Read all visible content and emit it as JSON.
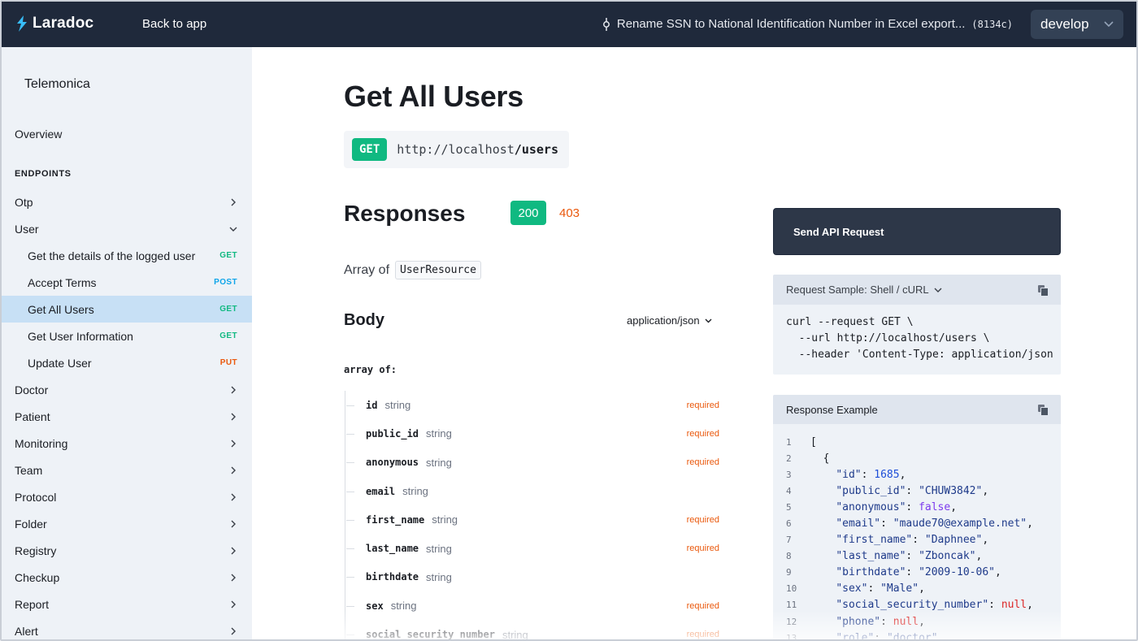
{
  "topbar": {
    "brand": "Laradoc",
    "back_link": "Back to app",
    "commit_message": "Rename SSN to National Identification Number in Excel export...",
    "commit_hash": "(8134c)",
    "branch": "develop"
  },
  "sidebar": {
    "project": "Telemonica",
    "overview": "Overview",
    "section": "ENDPOINTS",
    "items": [
      {
        "label": "Otp",
        "type": "group",
        "expanded": false
      },
      {
        "label": "User",
        "type": "group",
        "expanded": true
      },
      {
        "label": "Get the details of the logged user",
        "type": "endpoint",
        "method": "GET"
      },
      {
        "label": "Accept Terms",
        "type": "endpoint",
        "method": "POST"
      },
      {
        "label": "Get All Users",
        "type": "endpoint",
        "method": "GET",
        "active": true
      },
      {
        "label": "Get User Information",
        "type": "endpoint",
        "method": "GET"
      },
      {
        "label": "Update User",
        "type": "endpoint",
        "method": "PUT"
      },
      {
        "label": "Doctor",
        "type": "group",
        "expanded": false
      },
      {
        "label": "Patient",
        "type": "group",
        "expanded": false
      },
      {
        "label": "Monitoring",
        "type": "group",
        "expanded": false
      },
      {
        "label": "Team",
        "type": "group",
        "expanded": false
      },
      {
        "label": "Protocol",
        "type": "group",
        "expanded": false
      },
      {
        "label": "Folder",
        "type": "group",
        "expanded": false
      },
      {
        "label": "Registry",
        "type": "group",
        "expanded": false
      },
      {
        "label": "Checkup",
        "type": "group",
        "expanded": false
      },
      {
        "label": "Report",
        "type": "group",
        "expanded": false
      },
      {
        "label": "Alert",
        "type": "group",
        "expanded": false
      }
    ]
  },
  "main": {
    "title": "Get All Users",
    "method": "GET",
    "url_base": "http://localhost",
    "url_path": "/users",
    "responses_title": "Responses",
    "status_codes": [
      "200",
      "403"
    ],
    "array_of_label": "Array of",
    "resource_name": "UserResource",
    "body_title": "Body",
    "content_type": "application/json",
    "array_label": "array of:",
    "fields": [
      {
        "name": "id",
        "type": "string",
        "required": "required"
      },
      {
        "name": "public_id",
        "type": "string",
        "required": "required"
      },
      {
        "name": "anonymous",
        "type": "string",
        "required": "required"
      },
      {
        "name": "email",
        "type": "string",
        "required": ""
      },
      {
        "name": "first_name",
        "type": "string",
        "required": "required"
      },
      {
        "name": "last_name",
        "type": "string",
        "required": "required"
      },
      {
        "name": "birthdate",
        "type": "string",
        "required": ""
      },
      {
        "name": "sex",
        "type": "string",
        "required": "required"
      },
      {
        "name": "social_security_number",
        "type": "string",
        "required": "required"
      }
    ]
  },
  "panel": {
    "send_button": "Send API Request",
    "sample_label": "Request Sample: Shell / cURL",
    "sample_lines": [
      "curl --request GET \\",
      "  --url http://localhost/users \\",
      "  --header 'Content-Type: application/json"
    ],
    "response_label": "Response Example",
    "response_lines": [
      {
        "n": "1",
        "indent": 0,
        "kind": "punct",
        "text": "["
      },
      {
        "n": "2",
        "indent": 1,
        "kind": "punct",
        "text": "{"
      },
      {
        "n": "3",
        "indent": 2,
        "kind": "pair",
        "key": "\"id\"",
        "vtype": "num",
        "value": "1685"
      },
      {
        "n": "4",
        "indent": 2,
        "kind": "pair",
        "key": "\"public_id\"",
        "vtype": "str",
        "value": "\"CHUW3842\""
      },
      {
        "n": "5",
        "indent": 2,
        "kind": "pair",
        "key": "\"anonymous\"",
        "vtype": "bool",
        "value": "false"
      },
      {
        "n": "6",
        "indent": 2,
        "kind": "pair",
        "key": "\"email\"",
        "vtype": "str",
        "value": "\"maude70@example.net\""
      },
      {
        "n": "7",
        "indent": 2,
        "kind": "pair",
        "key": "\"first_name\"",
        "vtype": "str",
        "value": "\"Daphnee\""
      },
      {
        "n": "8",
        "indent": 2,
        "kind": "pair",
        "key": "\"last_name\"",
        "vtype": "str",
        "value": "\"Zboncak\""
      },
      {
        "n": "9",
        "indent": 2,
        "kind": "pair",
        "key": "\"birthdate\"",
        "vtype": "str",
        "value": "\"2009-10-06\""
      },
      {
        "n": "10",
        "indent": 2,
        "kind": "pair",
        "key": "\"sex\"",
        "vtype": "str",
        "value": "\"Male\""
      },
      {
        "n": "11",
        "indent": 2,
        "kind": "pair",
        "key": "\"social_security_number\"",
        "vtype": "null",
        "value": "null"
      },
      {
        "n": "12",
        "indent": 2,
        "kind": "pair",
        "key": "\"phone\"",
        "vtype": "null",
        "value": "null"
      },
      {
        "n": "13",
        "indent": 2,
        "kind": "pair",
        "key": "\"role\"",
        "vtype": "str",
        "value": "\"doctor\""
      }
    ]
  },
  "colors": {
    "topbar_bg": "#1f293b",
    "sidebar_bg": "#eef2f7",
    "active_row": "#c7e0f5",
    "get": "#10b981",
    "post": "#0ea5e9",
    "put": "#ea580c",
    "required": "#ea580c",
    "send_button_bg": "#2d3748"
  },
  "icons": [
    "laradoc-logo-icon",
    "commit-icon",
    "chevron-down-icon",
    "chevron-right-icon",
    "copy-icon"
  ]
}
